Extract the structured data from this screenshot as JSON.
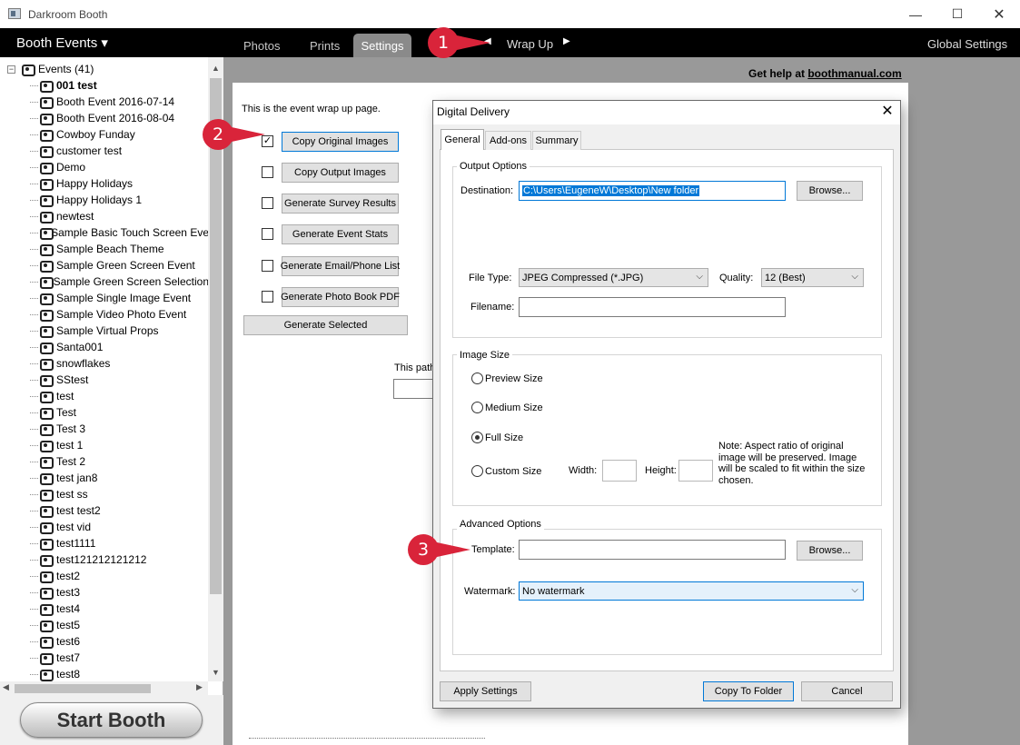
{
  "window": {
    "title": "Darkroom Booth",
    "min_glyph": "—",
    "max_glyph": "☐",
    "close_glyph": "✕"
  },
  "menubar": {
    "booth_events": "Booth Events ▾",
    "tabs": [
      {
        "label": "Photos"
      },
      {
        "label": "Prints"
      },
      {
        "label": "Settings"
      }
    ],
    "active_tab": "Settings",
    "wrapup": {
      "prev": "◀",
      "label": "Wrap Up",
      "next": "▶"
    },
    "global_settings": "Global Settings"
  },
  "tree": {
    "root_expander": "−",
    "root_label": "Events (41)",
    "items": [
      "001 test",
      "Booth Event 2016-07-14",
      "Booth Event 2016-08-04",
      "Cowboy Funday",
      "customer test",
      "Demo",
      "Happy Holidays",
      "Happy Holidays  1",
      "newtest",
      "Sample Basic Touch Screen Eve",
      "Sample Beach Theme",
      "Sample Green Screen Event",
      "Sample Green Screen Selection",
      "Sample Single Image Event",
      "Sample Video Photo Event",
      "Sample Virtual Props",
      "Santa001",
      "snowflakes",
      "SStest",
      "test",
      "Test",
      "Test   3",
      "test  1",
      "Test  2",
      "test jan8",
      "test ss",
      "test test2",
      "test vid",
      "test1111",
      "test121212121212",
      "test2",
      "test3",
      "test4",
      "test5",
      "test6",
      "test7",
      "test8"
    ],
    "selected_bold_index": 0,
    "scroll_up": "▲",
    "scroll_down": "▼",
    "scroll_left": "◀",
    "scroll_right": "▶"
  },
  "start_booth": "Start Booth",
  "main": {
    "help_prefix": "Get help at ",
    "help_link": "boothmanual.com",
    "intro": "This is the event wrap up page.",
    "options": [
      {
        "label": "Copy Original Images",
        "checked": true
      },
      {
        "label": "Copy Output Images",
        "checked": false
      },
      {
        "label": "Generate Survey Results",
        "checked": false
      },
      {
        "label": "Generate Event Stats",
        "checked": false
      },
      {
        "label": "Generate Email/Phone List",
        "checked": false
      },
      {
        "label": "Generate Photo Book PDF",
        "checked": false
      }
    ],
    "check_glyph": "✓",
    "generate_selected": "Generate Selected",
    "path_text": "This path"
  },
  "dialog": {
    "title": "Digital Delivery",
    "close_glyph": "✕",
    "tabs": [
      "General",
      "Add-ons",
      "Summary"
    ],
    "active_tab": "General",
    "output": {
      "title": "Output Options",
      "destination_label": "Destination:",
      "destination_value": "C:\\Users\\EugeneW\\Desktop\\New folder",
      "browse": "Browse...",
      "filetype_label": "File Type:",
      "filetype_value": "JPEG Compressed (*.JPG)",
      "quality_label": "Quality:",
      "quality_value": "12 (Best)",
      "filename_label": "Filename:",
      "filename_value": ""
    },
    "image_size": {
      "title": "Image Size",
      "options": [
        "Preview Size",
        "Medium Size",
        "Full Size",
        "Custom Size"
      ],
      "selected": "Full Size",
      "width_label": "Width:",
      "height_label": "Height:",
      "note": "Note: Aspect ratio of original image will be preserved. Image will be scaled to fit within the size chosen."
    },
    "advanced": {
      "title": "Advanced Options",
      "template_label": "Template:",
      "template_value": "",
      "browse": "Browse...",
      "watermark_label": "Watermark:",
      "watermark_value": "No watermark"
    },
    "combo_arrow": "⌵",
    "buttons": {
      "apply": "Apply Settings",
      "copy": "Copy To Folder",
      "cancel": "Cancel"
    }
  },
  "callouts": [
    "1",
    "2",
    "3"
  ],
  "colors": {
    "callout": "#d9243a",
    "accent": "#0078d7",
    "menubar": "#000000",
    "gray_bg": "#999999"
  }
}
